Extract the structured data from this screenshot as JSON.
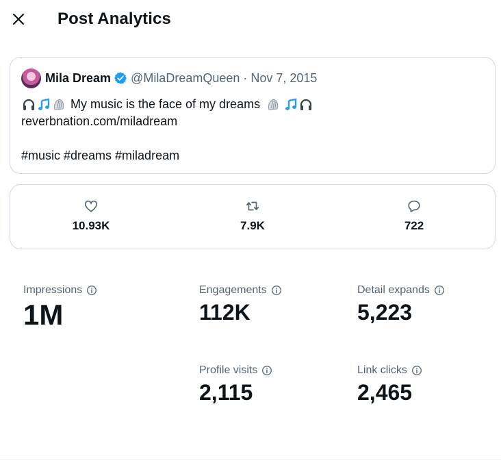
{
  "header": {
    "title": "Post Analytics",
    "close_icon": "close-icon"
  },
  "post": {
    "author_name": "Mila Dream",
    "handle": "@MilaDreamQueen",
    "separator": "·",
    "date": "Nov 7, 2015",
    "text": "My music is the face of my dreams",
    "link": "reverbnation.com/miladream",
    "hashtags": "#music #dreams #miladream",
    "leading_emojis": [
      "headphones-emoji",
      "music-notes-emoji",
      "shell-emoji"
    ],
    "trailing_emojis": [
      "shell-emoji",
      "music-notes-emoji",
      "headphones-emoji"
    ]
  },
  "engagement": {
    "likes": {
      "icon": "heart-icon",
      "value": "10.93K"
    },
    "reposts": {
      "icon": "repost-icon",
      "value": "7.9K"
    },
    "replies": {
      "icon": "reply-icon",
      "value": "722"
    }
  },
  "stats": {
    "impressions": {
      "label": "Impressions",
      "value": "1M"
    },
    "engagements": {
      "label": "Engagements",
      "value": "112K"
    },
    "detail_expands": {
      "label": "Detail expands",
      "value": "5,223"
    },
    "profile_visits": {
      "label": "Profile visits",
      "value": "2,115"
    },
    "link_clicks": {
      "label": "Link clicks",
      "value": "2,465"
    }
  },
  "colors": {
    "text_primary": "#0f1419",
    "text_secondary": "#536471",
    "verified": "#1d9bf0",
    "border": "#cfd9de"
  }
}
